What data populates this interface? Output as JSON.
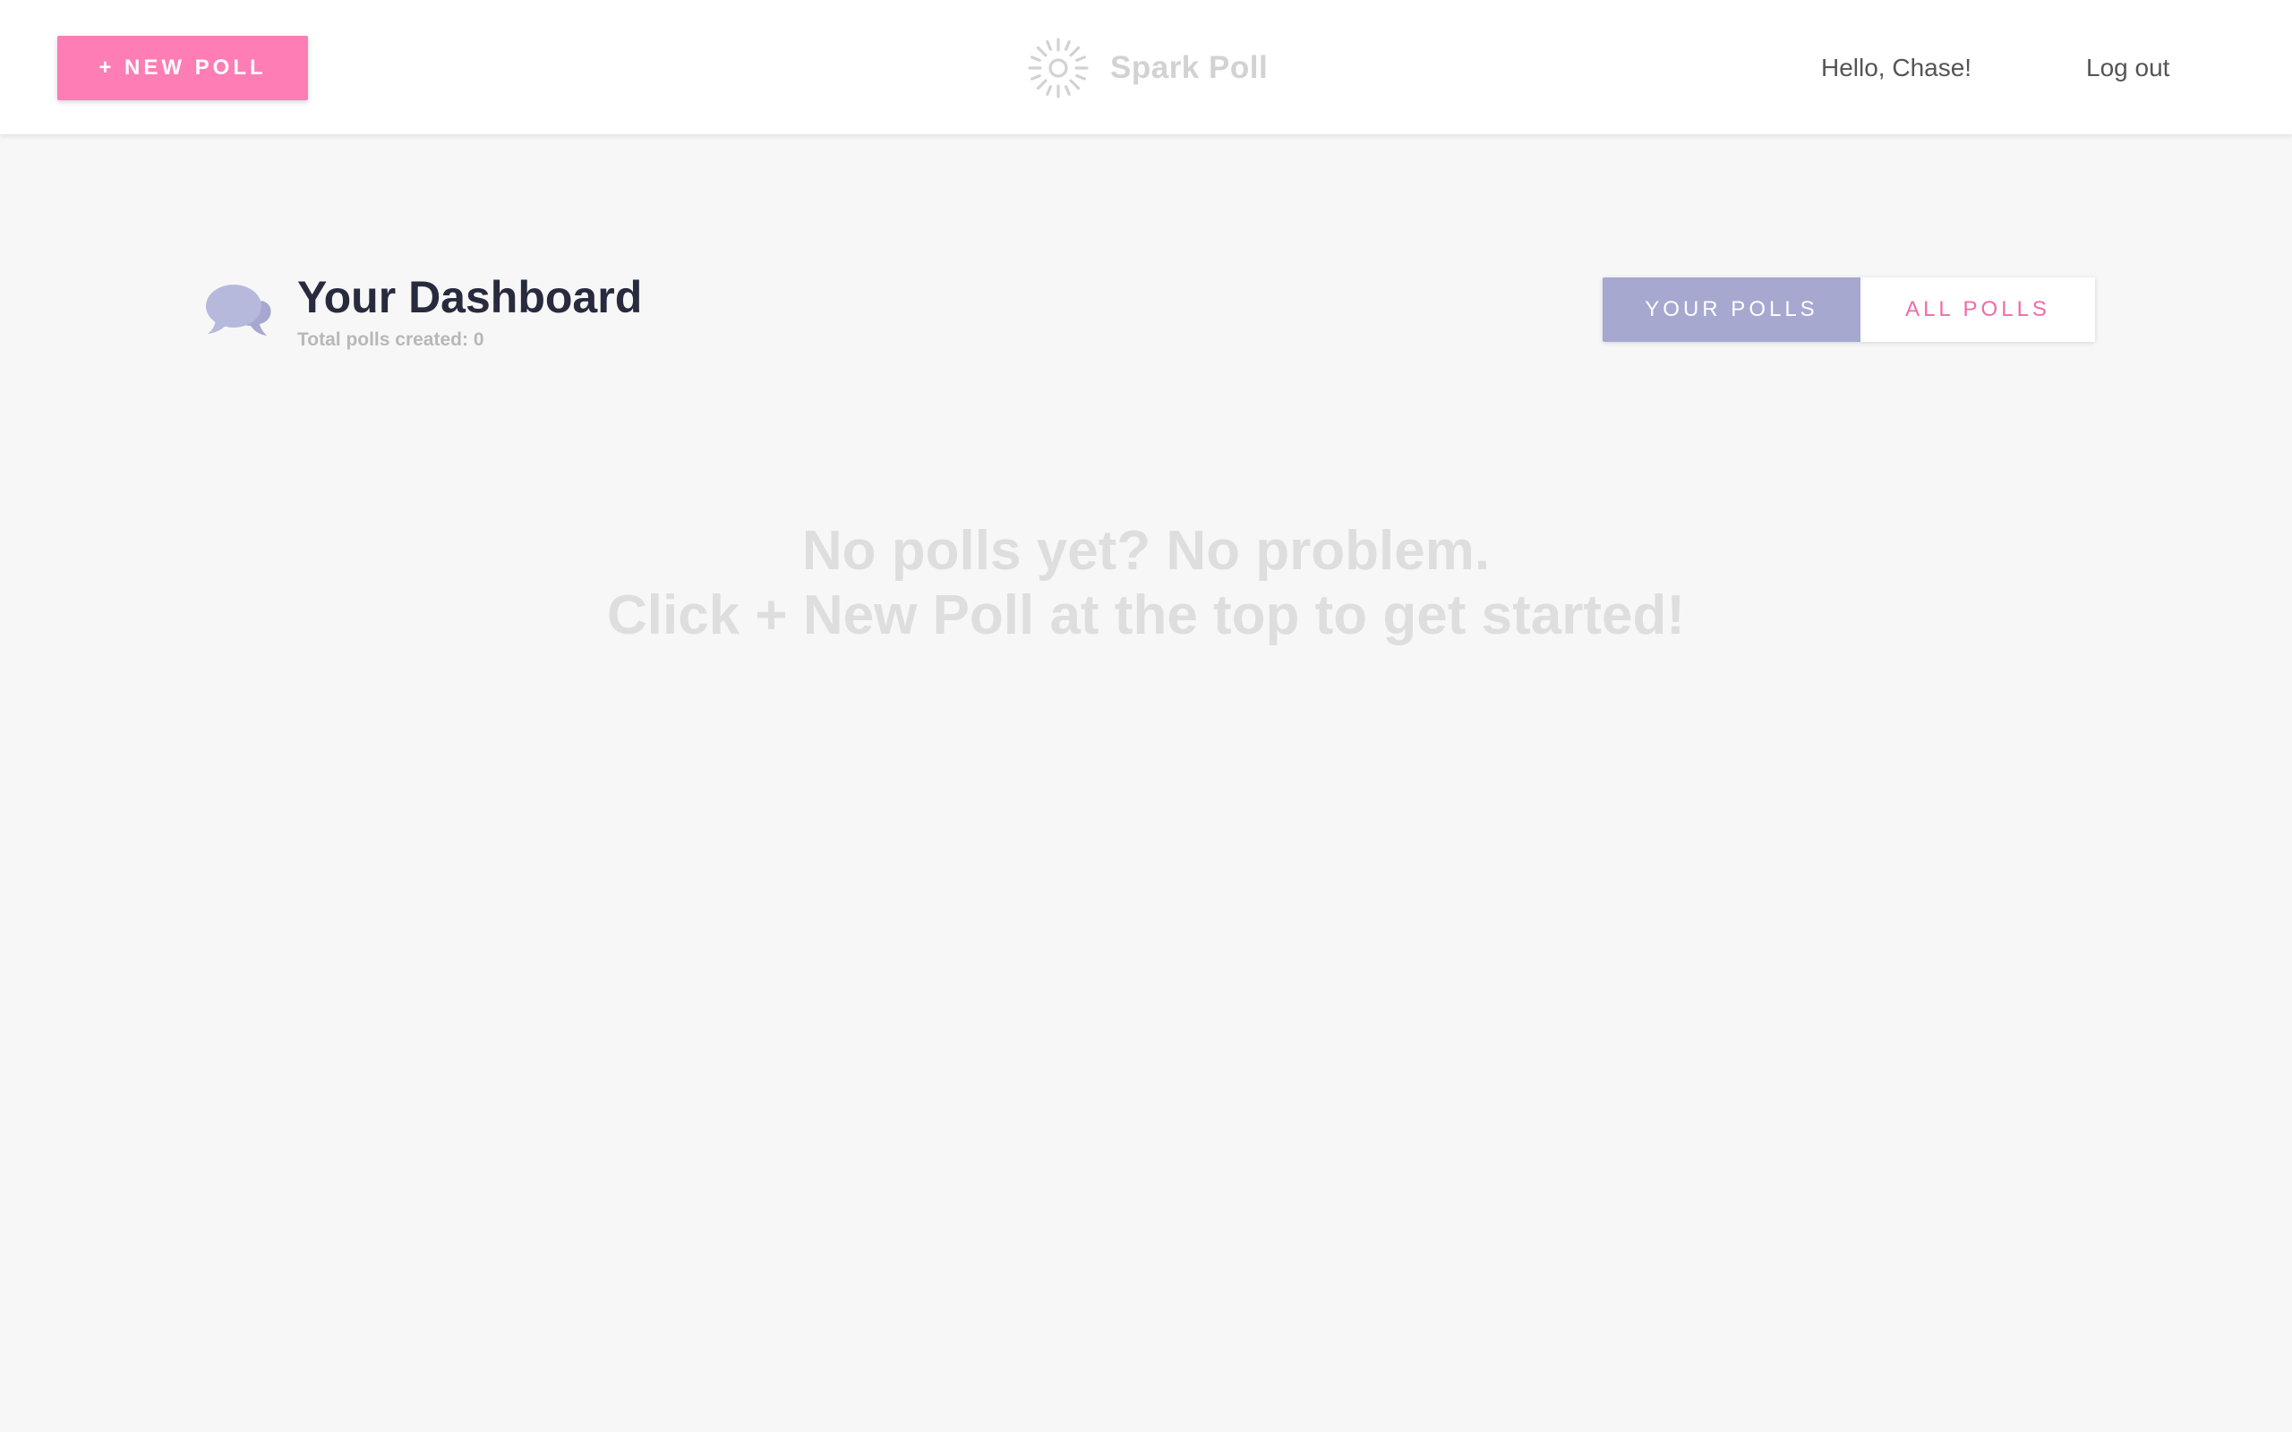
{
  "header": {
    "new_poll_label": "+ New Poll",
    "brand_name": "Spark Poll",
    "brand_icon": "sun-burst-icon",
    "greeting": "Hello, Chase!",
    "logout_label": "Log out"
  },
  "dashboard": {
    "icon": "chat-bubbles-icon",
    "title": "Your Dashboard",
    "subtitle": "Total polls created: 0",
    "tabs": [
      {
        "label": "Your Polls",
        "active": true
      },
      {
        "label": "All Polls",
        "active": false
      }
    ]
  },
  "empty_state": {
    "line1": "No polls yet? No problem.",
    "line2": "Click + New Poll at the top to get started!"
  },
  "colors": {
    "accent_pink": "#fd7db4",
    "accent_lavender": "#a6a8d0",
    "title_dark": "#282a3e",
    "background": "#f7f7f7"
  }
}
